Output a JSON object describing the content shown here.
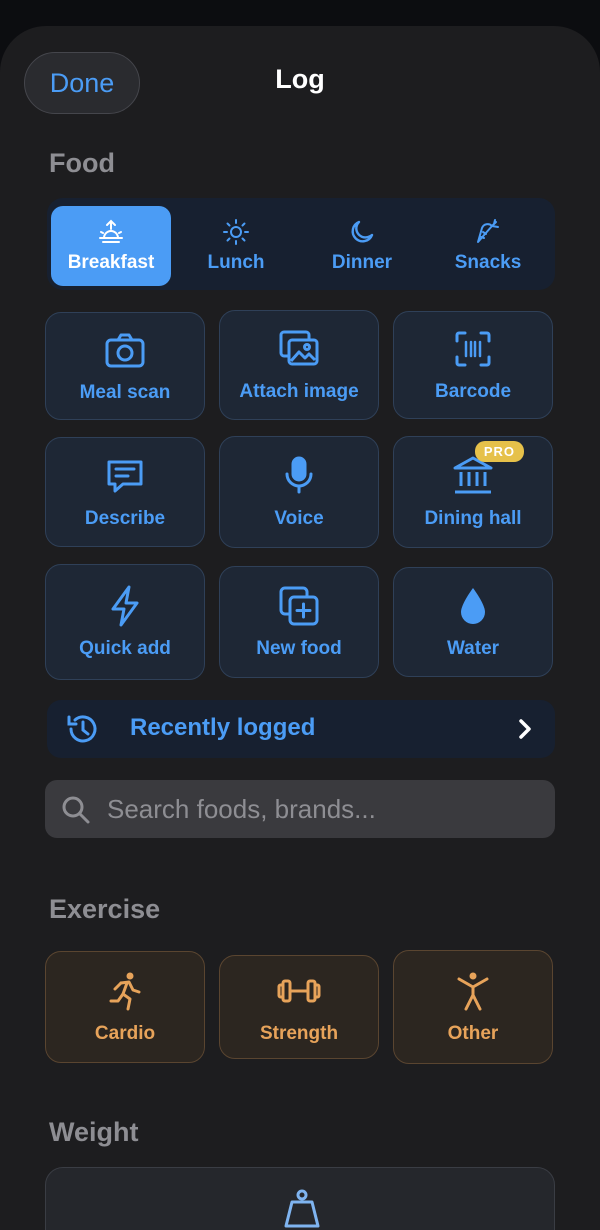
{
  "header": {
    "done_label": "Done",
    "title": "Log"
  },
  "food": {
    "section_title": "Food",
    "meal_tabs": [
      {
        "label": "Breakfast",
        "icon": "sunrise-icon",
        "active": true
      },
      {
        "label": "Lunch",
        "icon": "sun-icon",
        "active": false
      },
      {
        "label": "Dinner",
        "icon": "moon-icon",
        "active": false
      },
      {
        "label": "Snacks",
        "icon": "carrot-icon",
        "active": false
      }
    ],
    "actions": [
      {
        "label": "Meal scan",
        "icon": "camera-icon"
      },
      {
        "label": "Attach image",
        "icon": "images-icon"
      },
      {
        "label": "Barcode",
        "icon": "barcode-icon"
      },
      {
        "label": "Describe",
        "icon": "message-icon"
      },
      {
        "label": "Voice",
        "icon": "microphone-icon"
      },
      {
        "label": "Dining hall",
        "icon": "building-icon",
        "badge": "PRO"
      },
      {
        "label": "Quick add",
        "icon": "lightning-icon"
      },
      {
        "label": "New food",
        "icon": "add-copy-icon"
      },
      {
        "label": "Water",
        "icon": "water-drop-icon"
      }
    ],
    "recently_logged_label": "Recently logged",
    "search_placeholder": "Search foods, brands..."
  },
  "exercise": {
    "section_title": "Exercise",
    "actions": [
      {
        "label": "Cardio",
        "icon": "running-icon"
      },
      {
        "label": "Strength",
        "icon": "dumbbell-icon"
      },
      {
        "label": "Other",
        "icon": "person-stretch-icon"
      }
    ]
  },
  "weight": {
    "section_title": "Weight",
    "icon": "weight-scale-icon"
  },
  "colors": {
    "accent": "#4b9cf5",
    "exercise_accent": "#e7a35a",
    "pro_badge": "#e6c14a"
  }
}
